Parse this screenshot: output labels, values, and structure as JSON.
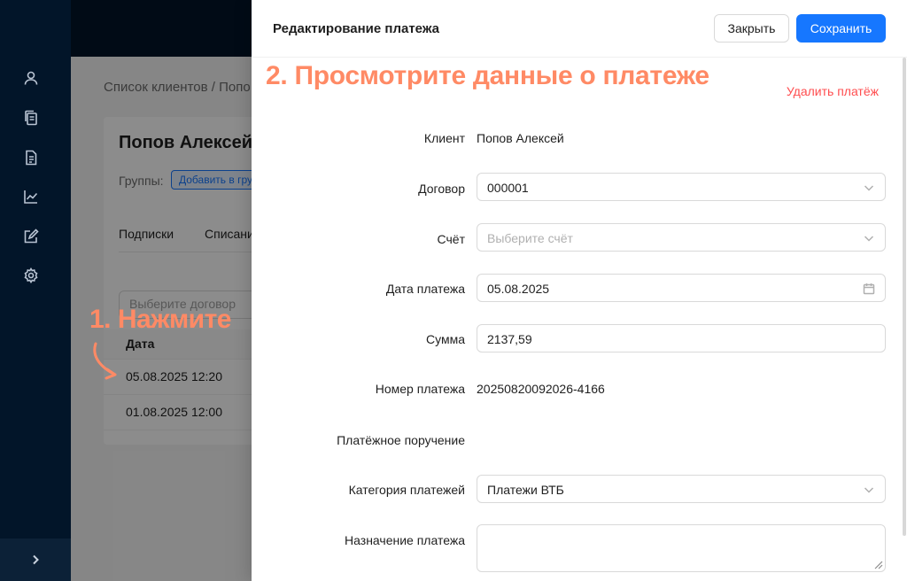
{
  "sidebar": {
    "icons": [
      "user-icon",
      "copy-documents-icon",
      "document-icon",
      "chart-icon",
      "edit-icon",
      "gear-icon"
    ],
    "collapse_icon": "chevron-right-icon"
  },
  "background": {
    "breadcrumb": "Список клиентов  /  Попо",
    "client_name": "Попов Алексей",
    "groups_label": "Группы:",
    "add_group_label": "Добавить в гру",
    "tabs": [
      "Подписки",
      "Списани"
    ],
    "contract_placeholder": "Выберите договор",
    "table_header": "Дата",
    "rows": [
      "05.08.2025 12:20",
      "01.08.2025 12:00"
    ]
  },
  "annotations": {
    "step1": "1. Нажмите",
    "step2": "2. Просмотрите данные о платеже"
  },
  "drawer": {
    "title": "Редактирование платежа",
    "close_label": "Закрыть",
    "save_label": "Сохранить",
    "delete_label": "Удалить платёж",
    "form": {
      "client_label": "Клиент",
      "client_value": "Попов Алексей",
      "contract_label": "Договор",
      "contract_value": "000001",
      "account_label": "Счёт",
      "account_placeholder": "Выберите счёт",
      "date_label": "Дата платежа",
      "date_value": "05.08.2025",
      "amount_label": "Сумма",
      "amount_value": "2137,59",
      "number_label": "Номер платежа",
      "number_value": "20250820092026-4166",
      "order_label": "Платёжное поручение",
      "category_label": "Категория платежей",
      "category_value": "Платежи ВТБ",
      "purpose_label": "Назначение платежа",
      "purpose_value": ""
    }
  },
  "colors": {
    "primary": "#1677ff",
    "danger": "#ff4d4f",
    "annotation": "#ff8a65",
    "sidebar": "#021529"
  }
}
